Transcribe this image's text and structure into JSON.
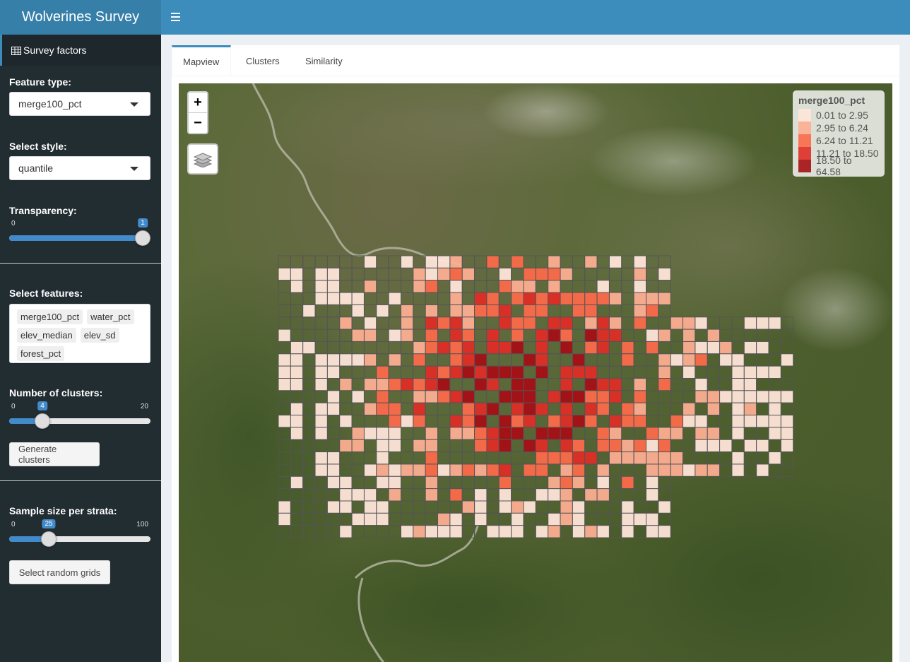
{
  "app": {
    "title": "Wolverines Survey"
  },
  "header": {
    "menu_icon": "hamburger-icon"
  },
  "sidebar": {
    "menu_item": {
      "label": "Survey factors",
      "icon": "table-icon"
    },
    "feature_type": {
      "label": "Feature type:",
      "value": "merge100_pct"
    },
    "style": {
      "label": "Select style:",
      "value": "quantile"
    },
    "transparency": {
      "label": "Transparency:",
      "min": "0",
      "value": "1",
      "fraction": 1.0
    },
    "features": {
      "label": "Select features:",
      "chips": [
        "merge100_pct",
        "water_pct",
        "elev_median",
        "elev_sd",
        "forest_pct"
      ]
    },
    "clusters": {
      "label": "Number of clusters:",
      "min": "0",
      "max": "20",
      "value": "4",
      "fraction": 0.2
    },
    "generate_button": "Generate clusters",
    "sample": {
      "label": "Sample size per strata:",
      "min": "0",
      "max": "100",
      "value": "25",
      "fraction": 0.25
    },
    "random_button": "Select random grids"
  },
  "tabs": [
    {
      "label": "Mapview",
      "active": true
    },
    {
      "label": "Clusters",
      "active": false
    },
    {
      "label": "Similarity",
      "active": false
    }
  ],
  "map": {
    "zoom_in": "+",
    "zoom_out": "−",
    "layers_icon": "layers-icon",
    "legend": {
      "title": "merge100_pct",
      "items": [
        {
          "label": "0.01 to 2.95",
          "color": "#fee5d9"
        },
        {
          "label": "2.95 to 6.24",
          "color": "#fcae91"
        },
        {
          "label": "6.24 to 11.21",
          "color": "#fb6a4a"
        },
        {
          "label": "11.21 to 18.50",
          "color": "#de2d26"
        },
        {
          "label": "18.50 to 64.58",
          "color": "#a50f15"
        }
      ]
    }
  }
}
